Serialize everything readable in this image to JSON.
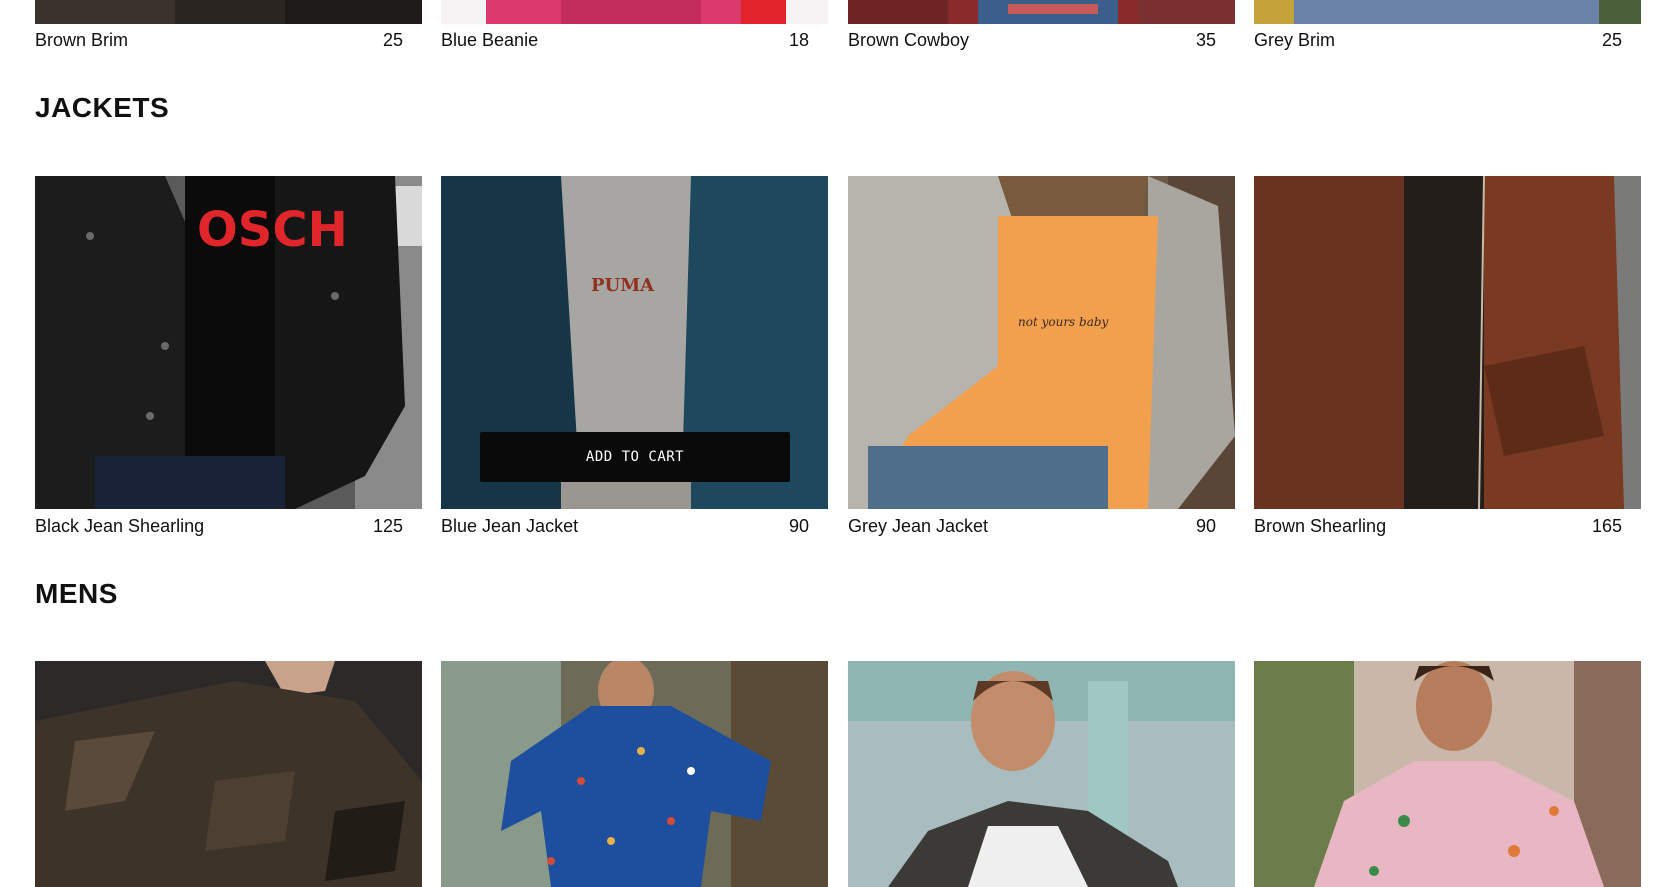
{
  "top_row": [
    {
      "name": "Brown Brim",
      "price": "25"
    },
    {
      "name": "Blue Beanie",
      "price": "18"
    },
    {
      "name": "Brown Cowboy",
      "price": "35"
    },
    {
      "name": "Grey Brim",
      "price": "25"
    }
  ],
  "jackets": {
    "title": "JACKETS",
    "items": [
      {
        "name": "Black Jean Shearling",
        "price": "125",
        "shirt_text": "OSCH"
      },
      {
        "name": "Blue Jean Jacket",
        "price": "90",
        "shirt_text": "PUMA"
      },
      {
        "name": "Grey Jean Jacket",
        "price": "90",
        "shirt_text": "not yours baby"
      },
      {
        "name": "Brown Shearling",
        "price": "165"
      }
    ]
  },
  "mens": {
    "title": "MENS"
  },
  "add_to_cart_label": "ADD TO CART"
}
